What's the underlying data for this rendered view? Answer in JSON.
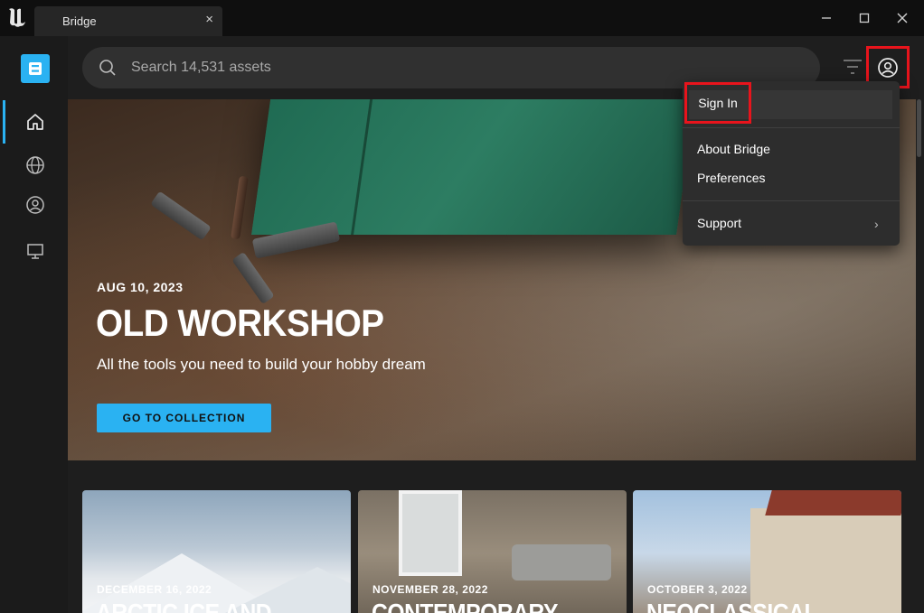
{
  "window": {
    "tab_title": "Bridge",
    "tab_close": "×",
    "minimize": "—",
    "maximize": "☐",
    "close": "✕"
  },
  "sidebar": {
    "brand_letter": "B",
    "items": [
      {
        "icon": "home-icon",
        "active": true
      },
      {
        "icon": "globe-icon",
        "active": false
      },
      {
        "icon": "user-circle-icon",
        "active": false
      },
      {
        "icon": "monitor-icon",
        "active": false
      }
    ]
  },
  "search": {
    "placeholder": "Search 14,531 assets",
    "value": ""
  },
  "hero": {
    "date": "AUG 10, 2023",
    "title": "OLD WORKSHOP",
    "subtitle": "All the tools you need to build your hobby dream",
    "cta": "GO TO COLLECTION"
  },
  "cards": [
    {
      "date": "DECEMBER 16, 2022",
      "title": "ARCTIC ICE AND"
    },
    {
      "date": "NOVEMBER 28, 2022",
      "title": "CONTEMPORARY"
    },
    {
      "date": "OCTOBER 3, 2022",
      "title": "NEOCLASSICAL"
    }
  ],
  "account_menu": {
    "sign_in": "Sign In",
    "about": "About Bridge",
    "preferences": "Preferences",
    "support": "Support",
    "support_chevron": "›"
  },
  "colors": {
    "accent": "#2ab2f2",
    "highlight": "#e8141c"
  }
}
